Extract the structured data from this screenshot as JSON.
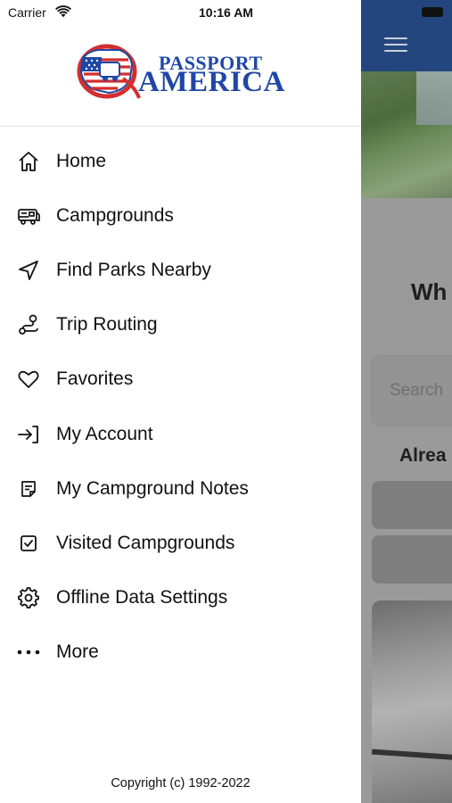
{
  "status_bar": {
    "carrier": "Carrier",
    "time": "10:16 AM"
  },
  "logo": {
    "line1": "PASSPORT",
    "line2": "AMERICA"
  },
  "menu": [
    {
      "label": "Home",
      "icon": "home-icon"
    },
    {
      "label": "Campgrounds",
      "icon": "rv-icon"
    },
    {
      "label": "Find Parks Nearby",
      "icon": "location-arrow-icon"
    },
    {
      "label": "Trip Routing",
      "icon": "route-icon"
    },
    {
      "label": "Favorites",
      "icon": "heart-icon"
    },
    {
      "label": "My Account",
      "icon": "sign-in-icon"
    },
    {
      "label": "My Campground Notes",
      "icon": "note-icon"
    },
    {
      "label": "Visited Campgrounds",
      "icon": "checkbox-icon"
    },
    {
      "label": "Offline Data Settings",
      "icon": "gear-icon"
    },
    {
      "label": "More",
      "icon": "more-dots-icon"
    }
  ],
  "copyright": "Copyright (c) 1992-2022",
  "background_screen": {
    "heading": "Wh",
    "search_placeholder": "Search",
    "already_text": "Alrea"
  },
  "colors": {
    "brand_blue": "#1f47a6",
    "brand_red": "#d32f2f",
    "navbar_bg": "#24467f"
  }
}
